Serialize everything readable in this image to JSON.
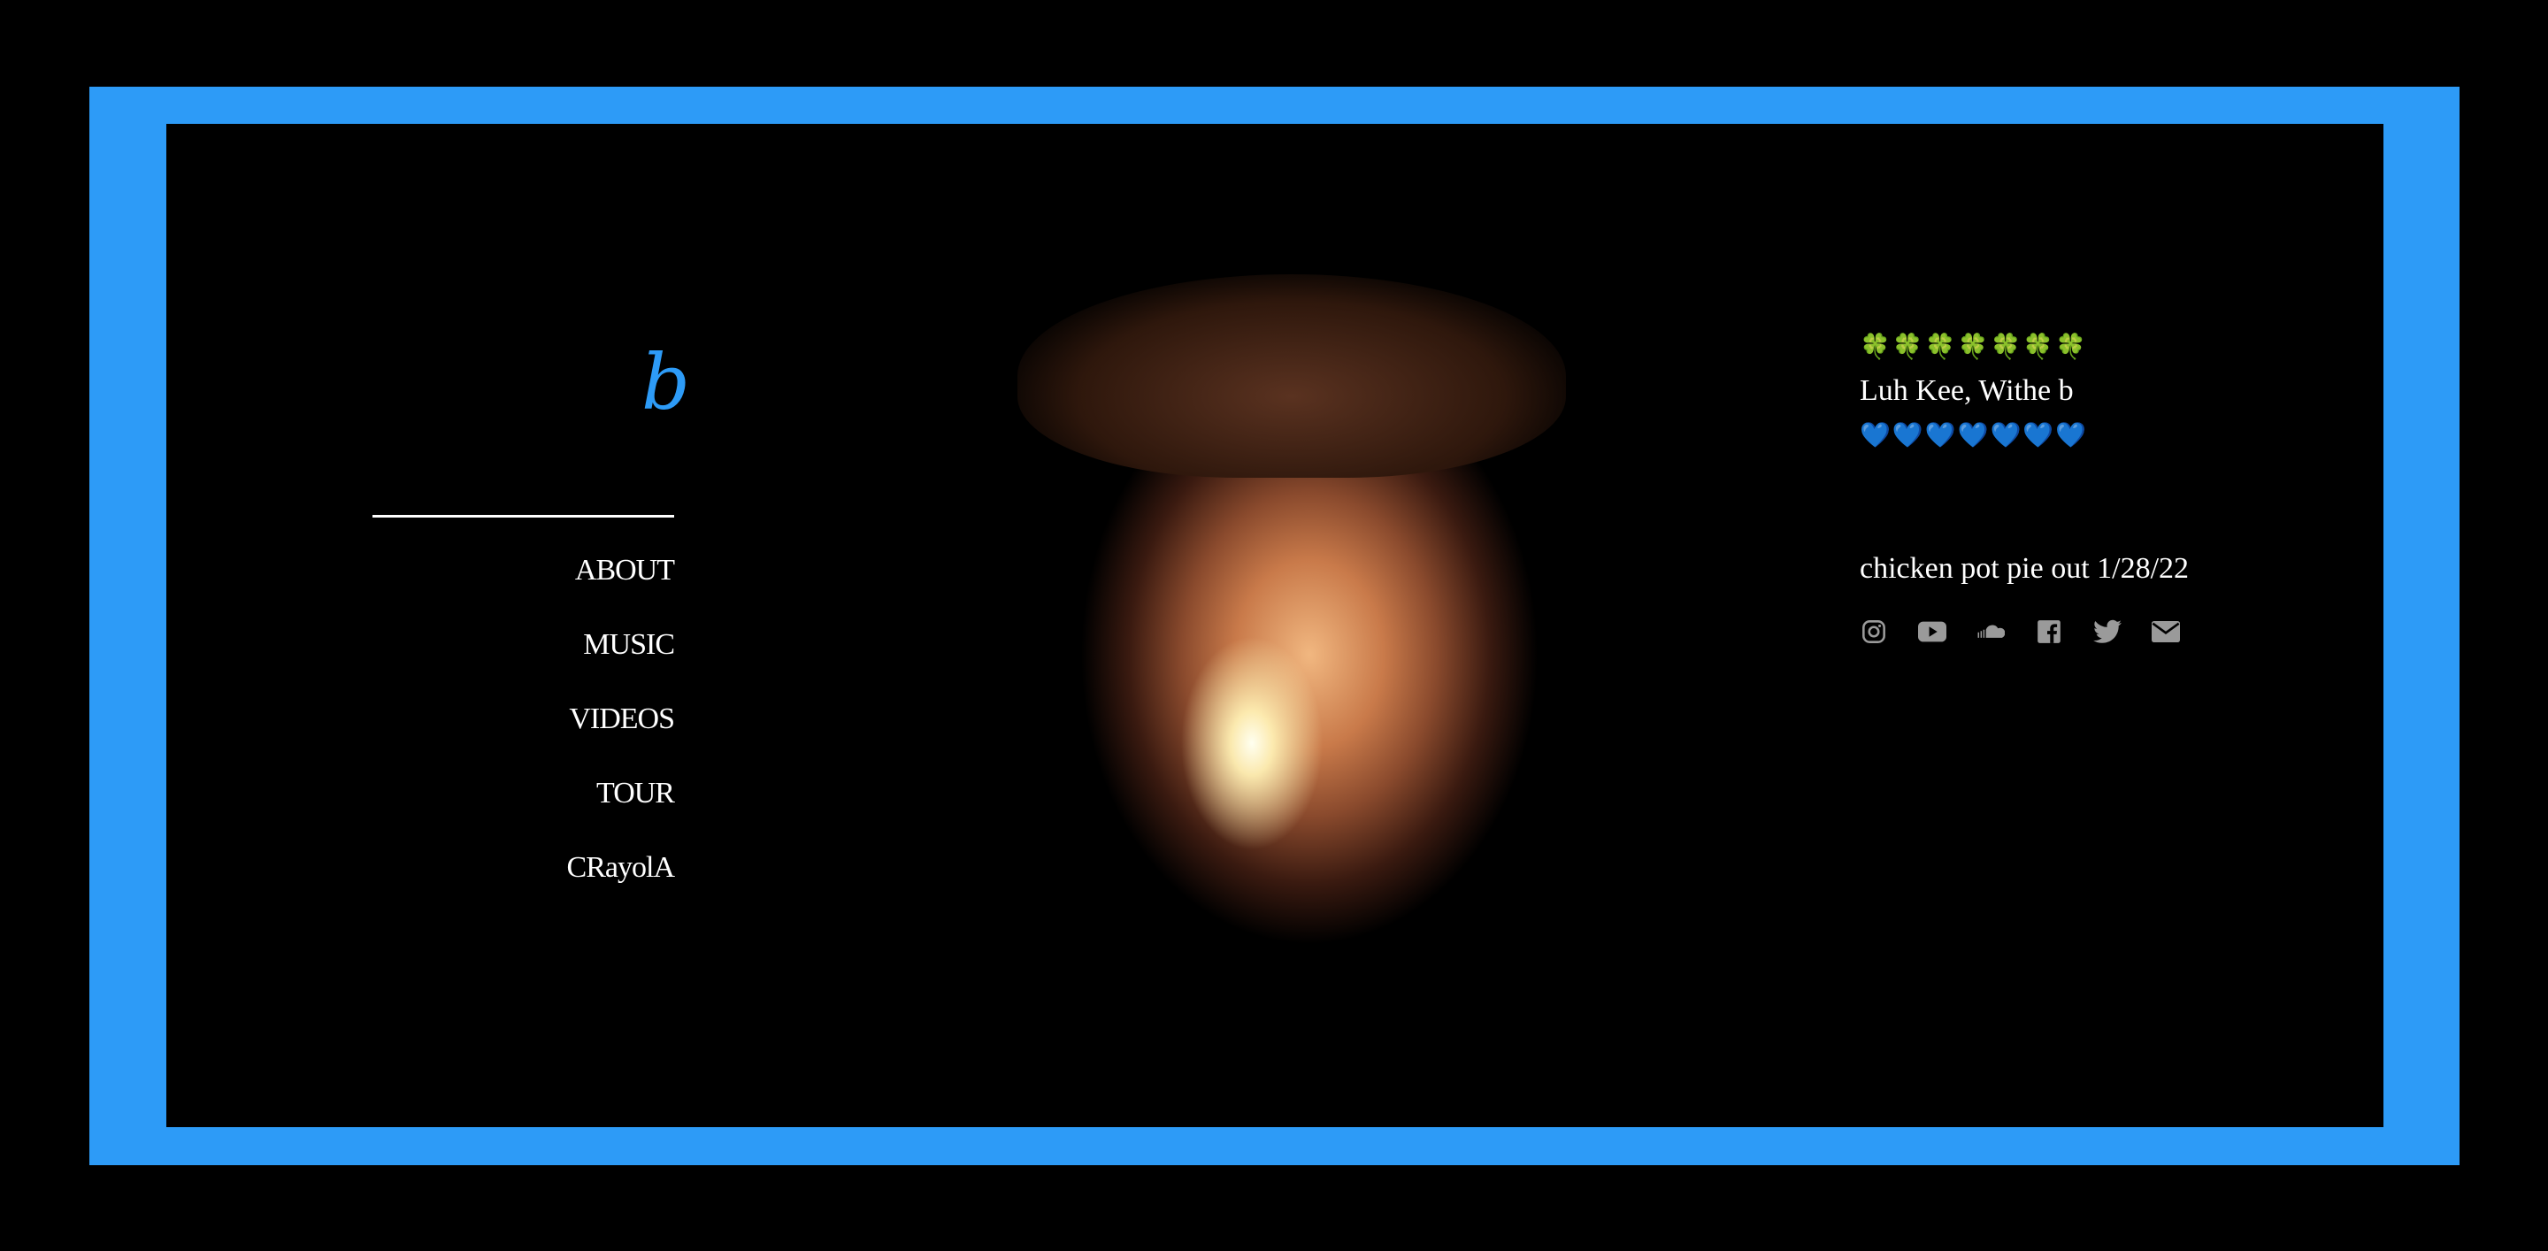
{
  "site": {
    "logo": "b"
  },
  "nav": {
    "items": [
      {
        "label": "ABOUT"
      },
      {
        "label": "MUSIC"
      },
      {
        "label": "VIDEOS"
      },
      {
        "label": "TOUR"
      },
      {
        "label": "CRayolA"
      }
    ]
  },
  "hero": {
    "clovers": "🍀🍀🍀🍀🍀🍀🍀",
    "tagline": "Luh Kee, Withe b",
    "hearts": "💙💙💙💙💙💙💙",
    "release": "chicken pot pie out 1/28/22"
  },
  "social": {
    "icons": [
      "instagram-icon",
      "youtube-icon",
      "soundcloud-icon",
      "facebook-icon",
      "twitter-icon",
      "email-icon"
    ]
  },
  "colors": {
    "accent": "#2d9bf7",
    "background": "#000000",
    "text": "#ffffff",
    "icon": "#9a9a9a"
  }
}
